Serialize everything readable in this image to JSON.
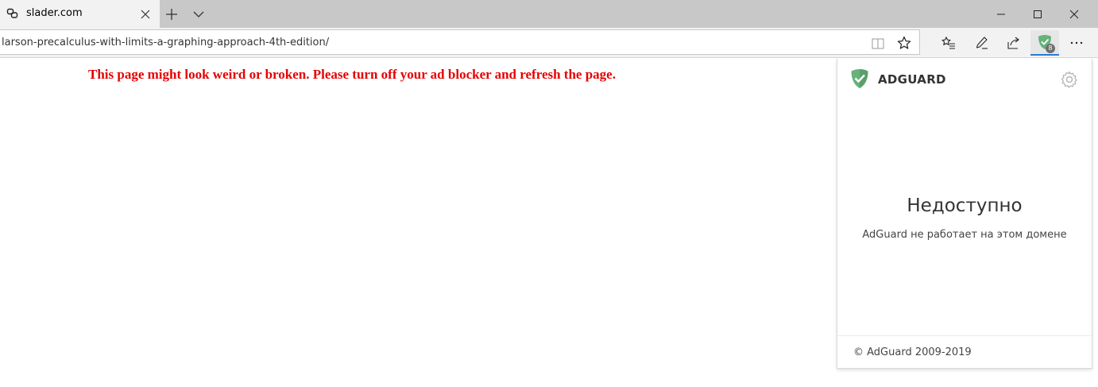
{
  "tab": {
    "title": "slader.com",
    "favicon": "slader-favicon-icon"
  },
  "addressbar": {
    "url": "larson-precalculus-with-limits-a-graphing-approach-4th-edition/"
  },
  "toolbar": {
    "adguard_badge_count": "8"
  },
  "page": {
    "warning": "This page might look weird or broken. Please turn off your ad blocker and refresh the page.",
    "warning_color": "#e50000"
  },
  "popup": {
    "brand": "ADGUARD",
    "status": "Недоступно",
    "description": "AdGuard не работает на этом домене",
    "footer": "© AdGuard 2009-2019",
    "brand_color": "#67b279"
  }
}
